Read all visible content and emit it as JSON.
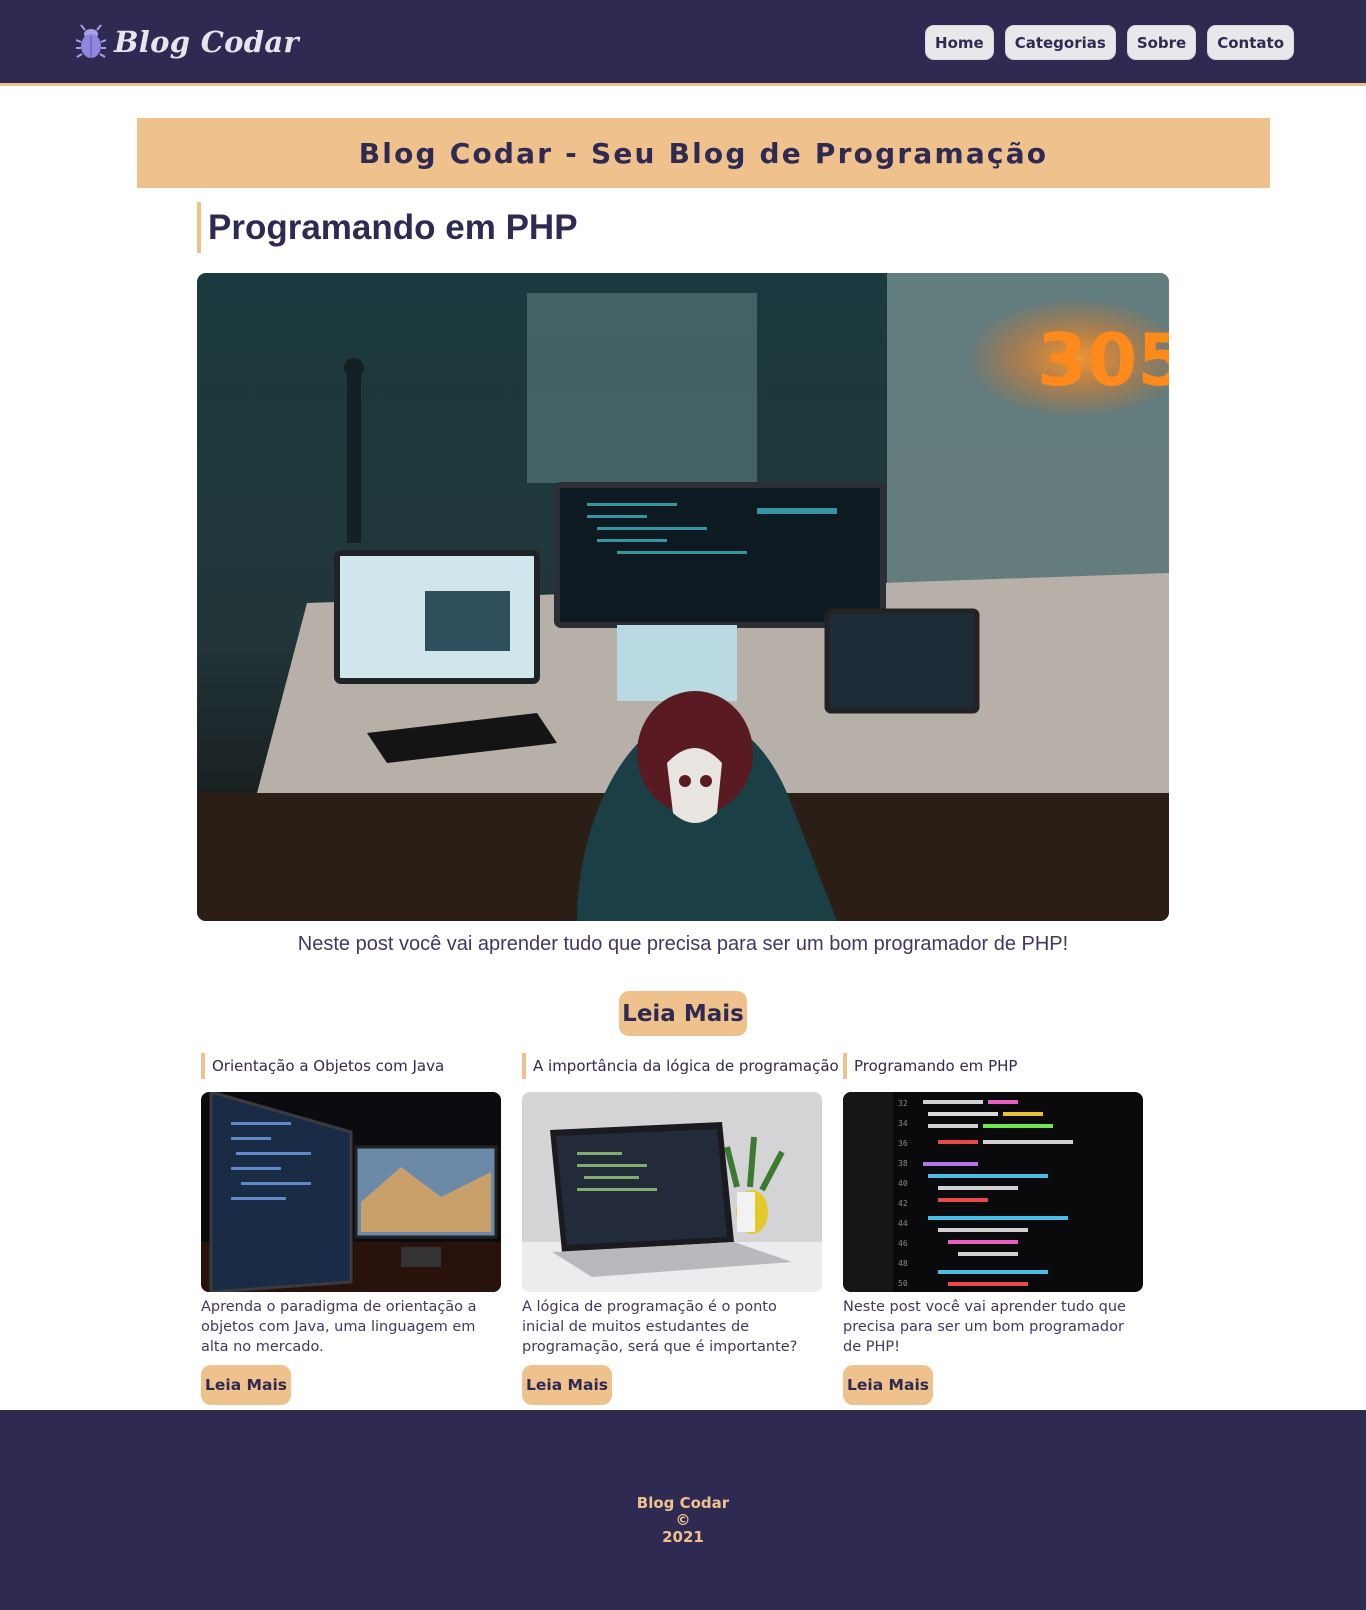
{
  "brand": {
    "title": "Blog Codar",
    "icon": "bug-icon"
  },
  "nav": {
    "items": [
      "Home",
      "Categorias",
      "Sobre",
      "Contato"
    ]
  },
  "banner": {
    "text": "Blog Codar - Seu Blog de Programação"
  },
  "featured": {
    "title": "Programando em PHP",
    "description": "Neste post você vai aprender tudo que precisa para ser um bom programador de PHP!",
    "button": "Leia Mais"
  },
  "cards": [
    {
      "title": "Orientação a Objetos com Java",
      "text": "Aprenda o paradigma de orientação a objetos com Java, uma linguagem em alta no mercado.",
      "button": "Leia Mais"
    },
    {
      "title": "A importância da lógica de programação",
      "text": "A lógica de programação é o ponto inicial de muitos estudantes de programação, será que é importante?",
      "button": "Leia Mais"
    },
    {
      "title": "Programando em PHP",
      "text": "Neste post você vai aprender tudo que precisa para ser um bom programador de PHP!",
      "button": "Leia Mais"
    }
  ],
  "footer": {
    "line1": "Blog Codar ©",
    "line2": "2021"
  },
  "colors": {
    "primary": "#2f2a51",
    "accent": "#efc28d",
    "nav_button": "#e8e8ea"
  }
}
